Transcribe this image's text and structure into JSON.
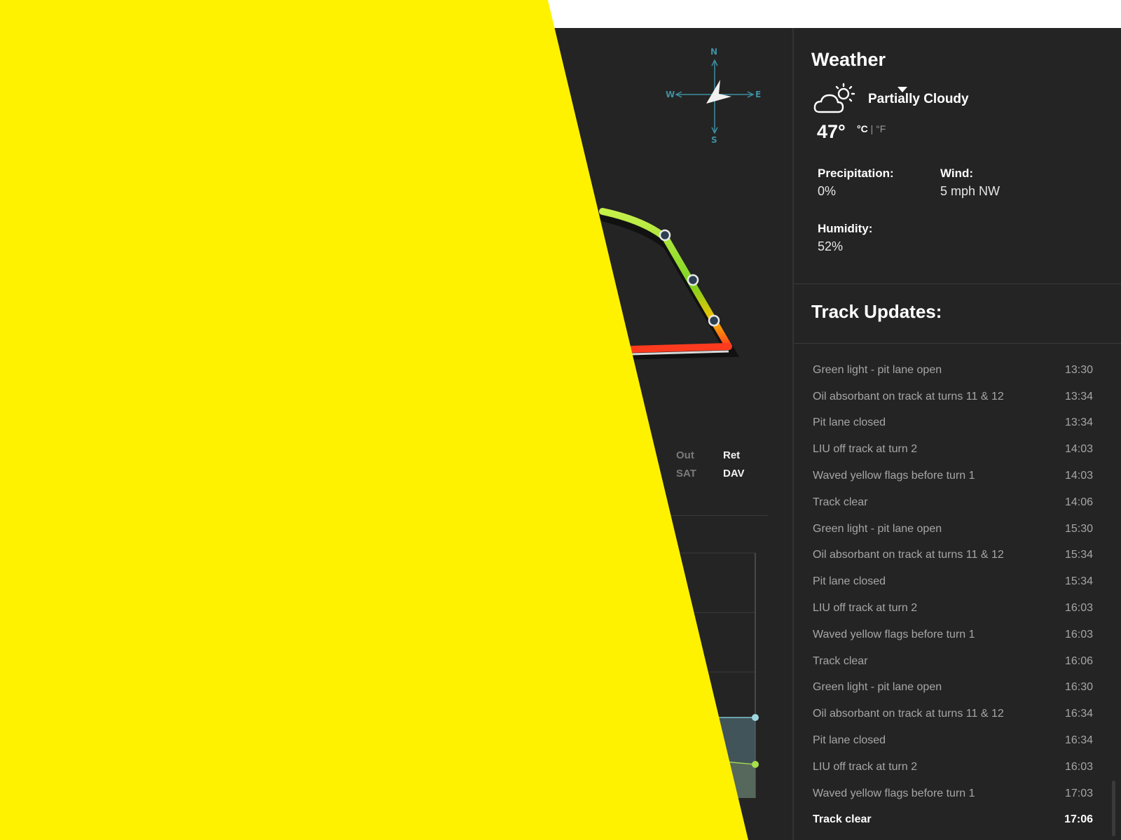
{
  "compass": {
    "n": "N",
    "s": "S",
    "e": "E",
    "w": "W"
  },
  "lap_info": {
    "out_label": "Out",
    "out_value": "SAT",
    "ret_label": "Ret",
    "ret_value": "DAV"
  },
  "weather": {
    "title": "Weather",
    "condition": "Partially Cloudy",
    "condition_icon": "cloud-sun-icon",
    "temperature": "47°",
    "unit_c": "°C",
    "unit_sep": "|",
    "unit_f": "°F",
    "precipitation_label": "Precipitation:",
    "precipitation_value": "0%",
    "wind_label": "Wind:",
    "wind_value": "5 mph NW",
    "humidity_label": "Humidity:",
    "humidity_value": "52%"
  },
  "track_updates": {
    "title": "Track Updates:",
    "items": [
      {
        "text": "Green light - pit lane open",
        "time": "13:30"
      },
      {
        "text": "Oil absorbant on track at turns 11 & 12",
        "time": "13:34"
      },
      {
        "text": "Pit lane closed",
        "time": "13:34"
      },
      {
        "text": "LIU off track at turn 2",
        "time": "14:03"
      },
      {
        "text": "Waved yellow flags before turn 1",
        "time": "14:03"
      },
      {
        "text": "Track clear",
        "time": "14:06"
      },
      {
        "text": "Green light - pit lane open",
        "time": "15:30"
      },
      {
        "text": "Oil absorbant on track at turns 11 & 12",
        "time": "15:34"
      },
      {
        "text": "Pit lane closed",
        "time": "15:34"
      },
      {
        "text": "LIU off track at turn 2",
        "time": "16:03"
      },
      {
        "text": "Waved yellow flags before turn 1",
        "time": "16:03"
      },
      {
        "text": "Track clear",
        "time": "16:06"
      },
      {
        "text": "Green light - pit lane open",
        "time": "16:30"
      },
      {
        "text": "Oil absorbant on track at turns 11 & 12",
        "time": "16:34"
      },
      {
        "text": "Pit lane closed",
        "time": "16:34"
      },
      {
        "text": "LIU off track at turn 2",
        "time": "16:03"
      },
      {
        "text": "Waved yellow flags before turn 1",
        "time": "17:03"
      },
      {
        "text": "Track clear",
        "time": "17:06"
      }
    ]
  },
  "colors": {
    "background": "#242424",
    "overlay_yellow": "#fff200",
    "compass": "#3d8fa0",
    "track_green": "#7ed321",
    "track_red": "#ff3b1f",
    "marker": "#2c3e50"
  }
}
